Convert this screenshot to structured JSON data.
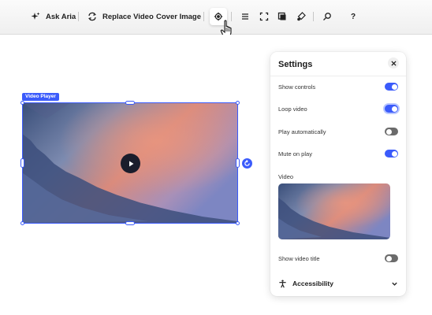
{
  "toolbar": {
    "ask_aria": "Ask Aria",
    "replace_video": "Replace Video",
    "cover_image": "Cover Image",
    "help": "?"
  },
  "element_tag": "Video Player",
  "settings": {
    "title": "Settings",
    "rows": [
      {
        "label": "Show controls",
        "on": true
      },
      {
        "label": "Loop video",
        "on": true
      },
      {
        "label": "Play automatically",
        "on": false
      },
      {
        "label": "Mute on play",
        "on": true
      }
    ],
    "video_label": "Video",
    "show_title": {
      "label": "Show video title",
      "on": false
    },
    "accessibility": "Accessibility"
  },
  "colors": {
    "accent": "#3b5bfb",
    "toggle_off": "#6b6b6b"
  }
}
